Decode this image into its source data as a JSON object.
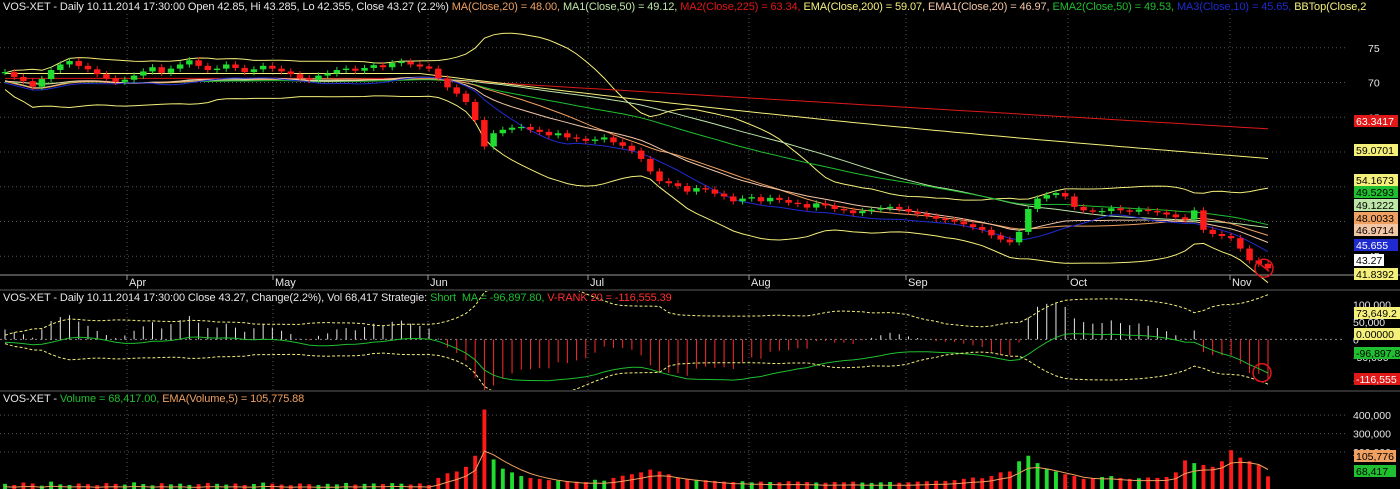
{
  "price_header": {
    "main": "VOS-XET - Daily 10.11.2014 17:30:00 Open 42.85, Hi 43.285, Lo 42.355, Close 43.27 (2.2%)",
    "ma": "MA(Close,20) = 48.00,",
    "ma1": "MA1(Close,50) = 49.12,",
    "ma2": "MA2(Close,225) = 63.34,",
    "ema": "EMA(Close,200) = 59.07,",
    "ema1": "EMA1(Close,20) = 46.97,",
    "ema2": "EMA2(Close,50) = 49.53,",
    "ma3": "MA3(Close,10) = 45.65,",
    "bb": "BBTop(Close,2"
  },
  "osc_header": {
    "main": "VOS-XET - Daily 10.11.2014 17:30:00 Close 43.27, Change(2.2%), Vol 68,417 Strategie:",
    "short": "Short  MA = -96,897.80,",
    "vrank": "V-RANK 20 = -116,555.39"
  },
  "vol_header": {
    "main": "VOS-XET -",
    "volume": "Volume = 68,417.00,",
    "ema": "EMA(Volume,5) = 105,775.88"
  },
  "months": [
    "Apr",
    "May",
    "Jun",
    "Jul",
    "Aug",
    "Sep",
    "Oct",
    "Nov"
  ],
  "price_axis": [
    "75",
    "70",
    "65",
    "60",
    "55",
    "50",
    "45"
  ],
  "price_badges": [
    {
      "text": "63.3417",
      "bg": "#e01818",
      "fg": "#ffffff"
    },
    {
      "text": "59.0701",
      "bg": "#f5f07a",
      "fg": "#000000"
    },
    {
      "text": "54.1673",
      "bg": "#f5f07a",
      "fg": "#000000"
    },
    {
      "text": "49.5293",
      "bg": "#1fbf2f",
      "fg": "#000000"
    },
    {
      "text": "49.1222",
      "bg": "#bde6a8",
      "fg": "#000000"
    },
    {
      "text": "48.0033",
      "bg": "#f0a060",
      "fg": "#000000"
    },
    {
      "text": "46.9714",
      "bg": "#f3c6a6",
      "fg": "#000000"
    },
    {
      "text": "45.655",
      "bg": "#1f2bd0",
      "fg": "#ffffff"
    },
    {
      "text": "43.27",
      "bg": "#ffffff",
      "fg": "#000000"
    },
    {
      "text": "41.8392",
      "bg": "#f5f07a",
      "fg": "#000000"
    }
  ],
  "osc_axis": [
    "100,000",
    "50,000",
    "0",
    "-50,000",
    "-116,555"
  ],
  "osc_badges": [
    {
      "text": "73,649.2",
      "bg": "#f5f07a",
      "fg": "#000000"
    },
    {
      "text": "0.00000",
      "bg": "#f5f07a",
      "fg": "#000000"
    },
    {
      "text": "-96,897.8",
      "bg": "#1fbf2f",
      "fg": "#000000"
    },
    {
      "text": "-116,555",
      "bg": "#e01818",
      "fg": "#ffffff"
    }
  ],
  "vol_axis": [
    "400,000",
    "300,000",
    "200,000"
  ],
  "vol_badges": [
    {
      "text": "105,776",
      "bg": "#f0a060",
      "fg": "#000000"
    },
    {
      "text": "68,417",
      "bg": "#1fbf2f",
      "fg": "#000000"
    }
  ],
  "colors": {
    "up": "#1fdc2f",
    "down": "#ff1a1a",
    "ma": "#f0a060",
    "ma1": "#bde6a8",
    "ma2": "#e01818",
    "ema": "#f5f07a",
    "ema1": "#f3c6a6",
    "ema2": "#1fbf2f",
    "ma3": "#1f2bd0",
    "bb": "#f5f07a"
  },
  "chart_data": {
    "type": "line",
    "series": [
      {
        "name": "Close",
        "values": [
          71.5,
          70.8,
          70.2,
          69.4,
          70.5,
          71.8,
          72.6,
          73.1,
          72.4,
          71.9,
          71.2,
          70.6,
          70.1,
          70.4,
          71.0,
          71.6,
          72.2,
          71.4,
          72.0,
          72.6,
          73.2,
          72.4,
          71.8,
          72.0,
          72.6,
          72.1,
          71.5,
          71.9,
          72.4,
          72.0,
          71.6,
          71.2,
          70.6,
          70.4,
          71.0,
          71.3,
          71.8,
          72.0,
          71.7,
          72.1,
          72.5,
          72.2,
          72.8,
          73.0,
          72.6,
          72.3,
          72.0,
          70.6,
          69.3,
          68.4,
          67.2,
          64.6,
          60.8,
          62.7,
          63.2,
          63.5,
          63.6,
          63.2,
          62.9,
          62.4,
          62.7,
          62.1,
          61.9,
          61.6,
          61.8,
          62.1,
          61.4,
          60.9,
          60.2,
          59.0,
          57.2,
          55.8,
          55.5,
          55.1,
          54.3,
          54.8,
          54.6,
          54.0,
          53.6,
          52.9,
          53.3,
          53.5,
          52.9,
          53.4,
          53.1,
          52.7,
          52.5,
          52.0,
          52.6,
          52.3,
          51.8,
          51.6,
          51.2,
          51.5,
          51.7,
          51.9,
          52.1,
          51.8,
          51.4,
          51.1,
          50.8,
          50.4,
          50.2,
          50.0,
          49.6,
          49.2,
          48.8,
          48.0,
          47.4,
          47.0,
          48.5,
          51.8,
          53.3,
          53.8,
          54.1,
          53.6,
          52.1,
          51.6,
          51.4,
          51.5,
          51.9,
          51.6,
          51.4,
          51.7,
          51.5,
          51.3,
          51.0,
          50.6,
          50.3,
          51.6,
          48.8,
          48.2,
          47.9,
          47.6,
          46.1,
          44.4,
          43.9,
          43.27
        ]
      },
      {
        "name": "MA(Close,20)",
        "last": 48.0
      },
      {
        "name": "MA1(Close,50)",
        "last": 49.12
      },
      {
        "name": "MA2(Close,225)",
        "last": 63.34
      },
      {
        "name": "EMA(Close,200)",
        "last": 59.07
      },
      {
        "name": "EMA1(Close,20)",
        "last": 46.97
      },
      {
        "name": "EMA2(Close,50)",
        "last": 49.53
      },
      {
        "name": "MA3(Close,10)",
        "last": 45.65
      }
    ],
    "ylim": [
      41,
      79
    ],
    "osc_ylim": [
      -140000,
      125000
    ],
    "vol_ylim": [
      0,
      460000
    ],
    "volumes": [
      28000,
      22000,
      35000,
      30000,
      18000,
      40000,
      25000,
      22000,
      30000,
      26000,
      21000,
      32000,
      28000,
      24000,
      36000,
      27000,
      20000,
      31000,
      25000,
      29000,
      22000,
      26000,
      33000,
      28000,
      24000,
      30000,
      22000,
      27000,
      35000,
      29000,
      24000,
      21000,
      30000,
      26000,
      22000,
      28000,
      25000,
      33000,
      24000,
      28000,
      30000,
      27000,
      32000,
      29000,
      24000,
      30000,
      22000,
      60000,
      85000,
      95000,
      120000,
      180000,
      430000,
      160000,
      110000,
      90000,
      70000,
      60000,
      55000,
      48000,
      45000,
      42000,
      40000,
      38000,
      50000,
      45000,
      60000,
      72000,
      80000,
      90000,
      105000,
      95000,
      80000,
      60000,
      55000,
      50000,
      48000,
      44000,
      40000,
      38000,
      42000,
      36000,
      40000,
      38000,
      36000,
      42000,
      40000,
      38000,
      35000,
      34000,
      38000,
      36000,
      40000,
      35000,
      33000,
      36000,
      38000,
      34000,
      36000,
      40000,
      42000,
      45000,
      44000,
      48000,
      55000,
      62000,
      58000,
      70000,
      90000,
      95000,
      150000,
      180000,
      140000,
      110000,
      95000,
      80000,
      70000,
      55000,
      60000,
      65000,
      70000,
      60000,
      55000,
      58000,
      62000,
      60000,
      65000,
      90000,
      155000,
      140000,
      130000,
      120000,
      150000,
      210000,
      170000,
      150000,
      130000,
      68417
    ],
    "volume_ema_last": 105775.88,
    "short_ma_last": -96897.8,
    "vrank_last": -116555.39
  }
}
